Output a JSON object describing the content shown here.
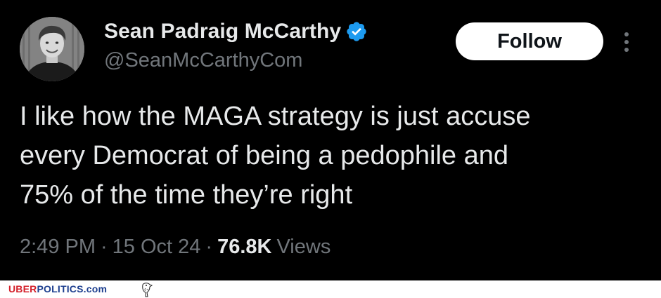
{
  "tweet": {
    "author": {
      "display_name": "Sean Padraig McCarthy",
      "handle": "@SeanMcCarthyCom",
      "verified": true,
      "verified_color": "#1d9bf0",
      "avatar_icon": "profile-photo"
    },
    "follow_label": "Follow",
    "more_icon": "more-vertical-icon",
    "text_lines": [
      "I like how the MAGA strategy is just accuse",
      "every Democrat of being a pedophile and",
      "75% of the time they’re right"
    ],
    "meta": {
      "time": "2:49 PM",
      "separator": "·",
      "date": "15 Oct 24",
      "views_count": "76.8K",
      "views_label": "Views"
    }
  },
  "watermark": {
    "part1": "UBER",
    "part2": "POLITICS.com",
    "icon": "eagle-icon"
  },
  "colors": {
    "background": "#000000",
    "text_primary": "#e7e9ea",
    "text_secondary": "#71767b",
    "follow_bg": "#ffffff",
    "follow_text": "#0f1419",
    "watermark_red": "#d4202a",
    "watermark_blue": "#1d3f8f"
  }
}
